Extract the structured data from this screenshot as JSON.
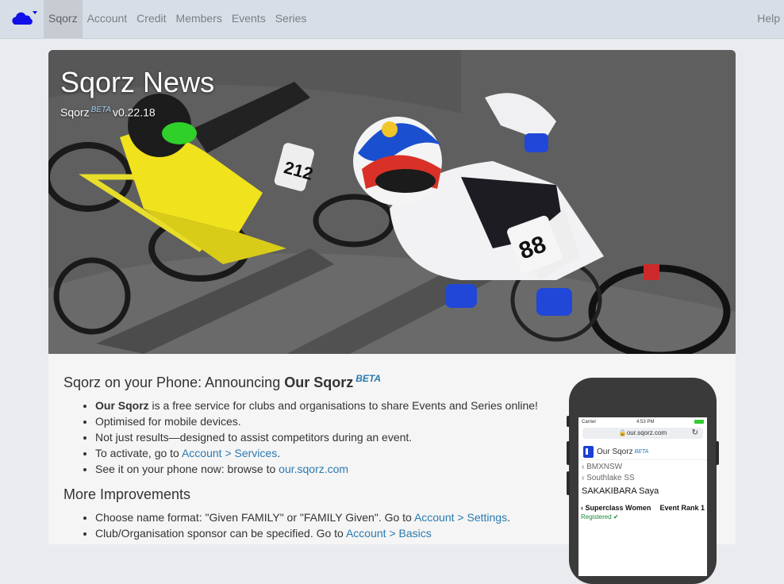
{
  "navbar": {
    "brand_icon": "cloud-dropdown-icon",
    "links": [
      "Sqorz",
      "Account",
      "Credit",
      "Members",
      "Events",
      "Series"
    ],
    "active_link": "Sqorz",
    "help_label": "Help"
  },
  "hero": {
    "title": "Sqorz News",
    "sub_name": "Sqorz",
    "sub_beta": "BETA",
    "sub_version": "v0.22.18"
  },
  "announce": {
    "heading_prefix": "Sqorz on your Phone: Announcing ",
    "heading_bold": "Our Sqorz",
    "heading_beta": "BETA",
    "b1_bold": "Our Sqorz",
    "b1_rest": " is a free service for clubs and organisations to share Events and Series online!",
    "b2": "Optimised for mobile devices.",
    "b3": "Not just results—designed to assist competitors during an event.",
    "b4_text": "To activate, go to ",
    "b4_link": "Account > Services",
    "b4_end": ".",
    "b5_text": "See it on your phone now: browse to ",
    "b5_link": "our.sqorz.com"
  },
  "improvements": {
    "heading": "More Improvements",
    "b1_text": "Choose name format: \"Given FAMILY\" or \"FAMILY Given\". Go to ",
    "b1_link": "Account > Settings",
    "b1_end": ".",
    "b2_text": "Club/Organisation sponsor can be specified. Go to ",
    "b2_link": "Account > Basics"
  },
  "phone": {
    "carrier": "Carrier",
    "time": "4:53 PM",
    "url": "our.sqorz.com",
    "app_name": "Our Sqorz",
    "app_beta": "BETA",
    "crumb1": "BMXNSW",
    "crumb2": "Southlake SS",
    "rider": "SAKAKIBARA Saya",
    "class": "Superclass Women",
    "rank": "Event Rank 1",
    "registered": "Registered"
  },
  "colors": {
    "navbar_bg": "#d8dee7",
    "link": "#2a7ab0",
    "brand_blue": "#1b3fd6"
  }
}
